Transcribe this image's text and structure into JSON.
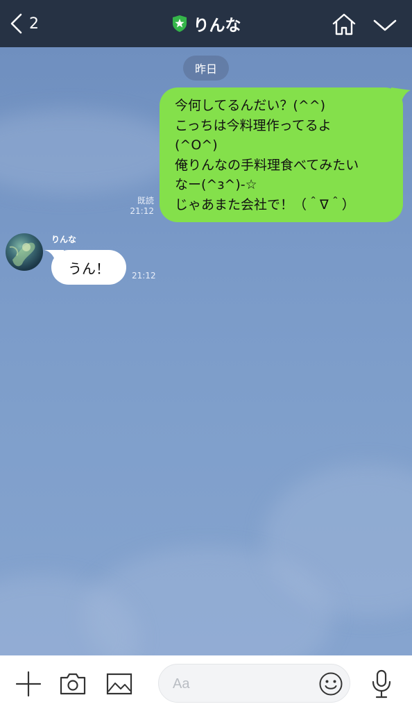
{
  "header": {
    "back_count": "2",
    "title": "りんな"
  },
  "chat": {
    "date_label": "昨日",
    "outgoing": {
      "lines": [
        "今何してるんだい？(^^)",
        "こっちは今料理作ってるよ",
        "(^O^)",
        "俺りんなの手料理食べてみたい",
        "なー(^з^)-☆",
        "じゃあまた会社で！（＾∇＾）"
      ],
      "read_label": "既読",
      "time": "21:12",
      "bubble_color": "#84e04b"
    },
    "incoming": {
      "sender": "りんな",
      "text": "うん！",
      "time": "21:12"
    }
  },
  "input": {
    "placeholder": "Aa"
  },
  "icons": {
    "back": "chevron-left-icon",
    "verified": "shield-star-icon",
    "home": "home-icon",
    "menu": "chevron-down-icon",
    "plus": "plus-icon",
    "camera": "camera-icon",
    "image": "image-icon",
    "emoji": "smiley-icon",
    "mic": "microphone-icon"
  },
  "colors": {
    "header_bg": "#263244",
    "chat_bg": "#7c9cc9",
    "verified_green": "#35b54a"
  }
}
